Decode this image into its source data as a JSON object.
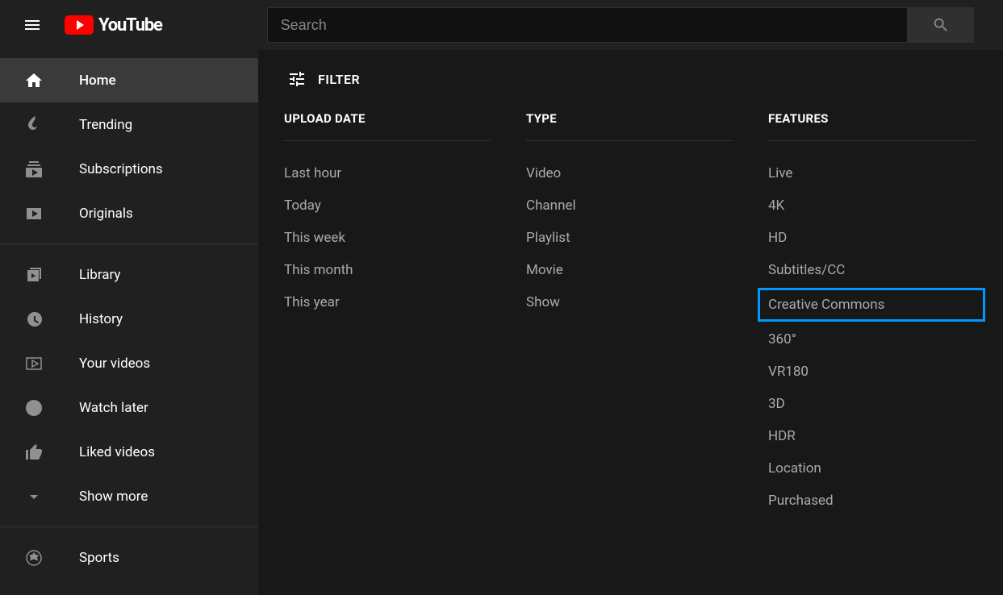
{
  "header": {
    "brand": "YouTube",
    "search_placeholder": "Search"
  },
  "sidebar": {
    "group1": [
      {
        "label": "Home",
        "icon": "home-icon",
        "active": true
      },
      {
        "label": "Trending",
        "icon": "flame-icon"
      },
      {
        "label": "Subscriptions",
        "icon": "subscriptions-icon"
      },
      {
        "label": "Originals",
        "icon": "originals-icon"
      }
    ],
    "group2": [
      {
        "label": "Library",
        "icon": "library-icon"
      },
      {
        "label": "History",
        "icon": "history-icon"
      },
      {
        "label": "Your videos",
        "icon": "your-videos-icon"
      },
      {
        "label": "Watch later",
        "icon": "clock-icon"
      },
      {
        "label": "Liked videos",
        "icon": "thumbs-up-icon"
      },
      {
        "label": "Show more",
        "icon": "chevron-down-icon"
      }
    ],
    "group3": [
      {
        "label": "Sports",
        "icon": "sports-icon"
      }
    ]
  },
  "filters": {
    "label": "FILTER",
    "columns": [
      {
        "title": "UPLOAD DATE",
        "options": [
          "Last hour",
          "Today",
          "This week",
          "This month",
          "This year"
        ]
      },
      {
        "title": "TYPE",
        "options": [
          "Video",
          "Channel",
          "Playlist",
          "Movie",
          "Show"
        ]
      },
      {
        "title": "FEATURES",
        "options": [
          "Live",
          "4K",
          "HD",
          "Subtitles/CC",
          "Creative Commons",
          "360°",
          "VR180",
          "3D",
          "HDR",
          "Location",
          "Purchased"
        ],
        "highlight": "Creative Commons"
      }
    ]
  }
}
